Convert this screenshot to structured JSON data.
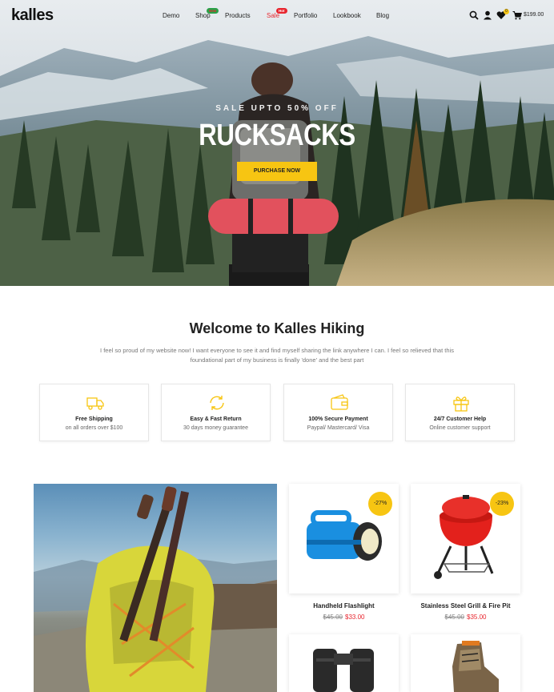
{
  "brand": {
    "logo": "kalles",
    "accent": "#f7c512",
    "sale_color": "#e8262f"
  },
  "nav": {
    "items": [
      {
        "label": "Demo"
      },
      {
        "label": "Shop",
        "badge": "New"
      },
      {
        "label": "Products"
      },
      {
        "label": "Sale",
        "badge": "Hot"
      },
      {
        "label": "Portfolio"
      },
      {
        "label": "Lookbook"
      },
      {
        "label": "Blog"
      }
    ],
    "icons": [
      "search-icon",
      "user-icon",
      "heart-icon",
      "cart-icon"
    ],
    "wishlist_count": "0",
    "cart_total": "$199.00"
  },
  "hero": {
    "kicker": "SALE UPTO 50% OFF",
    "title": "RUCKSACKS",
    "button": "PURCHASE NOW"
  },
  "welcome": {
    "title": "Welcome to Kalles Hiking",
    "text": "I feel so proud of my website now! I want everyone to see it and find myself sharing the link anywhere I can. I feel so relieved that this foundational part of my business is finally 'done' and the best part"
  },
  "features": [
    {
      "icon": "truck-icon",
      "title": "Free Shipping",
      "subtitle": "on all orders over $100"
    },
    {
      "icon": "refresh-icon",
      "title": "Easy & Fast Return",
      "subtitle": "30 days money guarantee"
    },
    {
      "icon": "wallet-icon",
      "title": "100% Secure Payment",
      "subtitle": "Paypal/ Mastercard/ Visa"
    },
    {
      "icon": "gift-icon",
      "title": "24/7 Customer Help",
      "subtitle": "Online customer support"
    }
  ],
  "products": [
    {
      "name": "Handheld Flashlight",
      "old_price": "$45.00",
      "price": "$33.00",
      "discount": "-27%"
    },
    {
      "name": "Stainless Steel Grill & Fire Pit",
      "old_price": "$45.00",
      "price": "$35.00",
      "discount": "-23%"
    },
    {
      "name": "",
      "old_price": "",
      "price": "",
      "discount": ""
    },
    {
      "name": "",
      "old_price": "",
      "price": "",
      "discount": ""
    }
  ]
}
